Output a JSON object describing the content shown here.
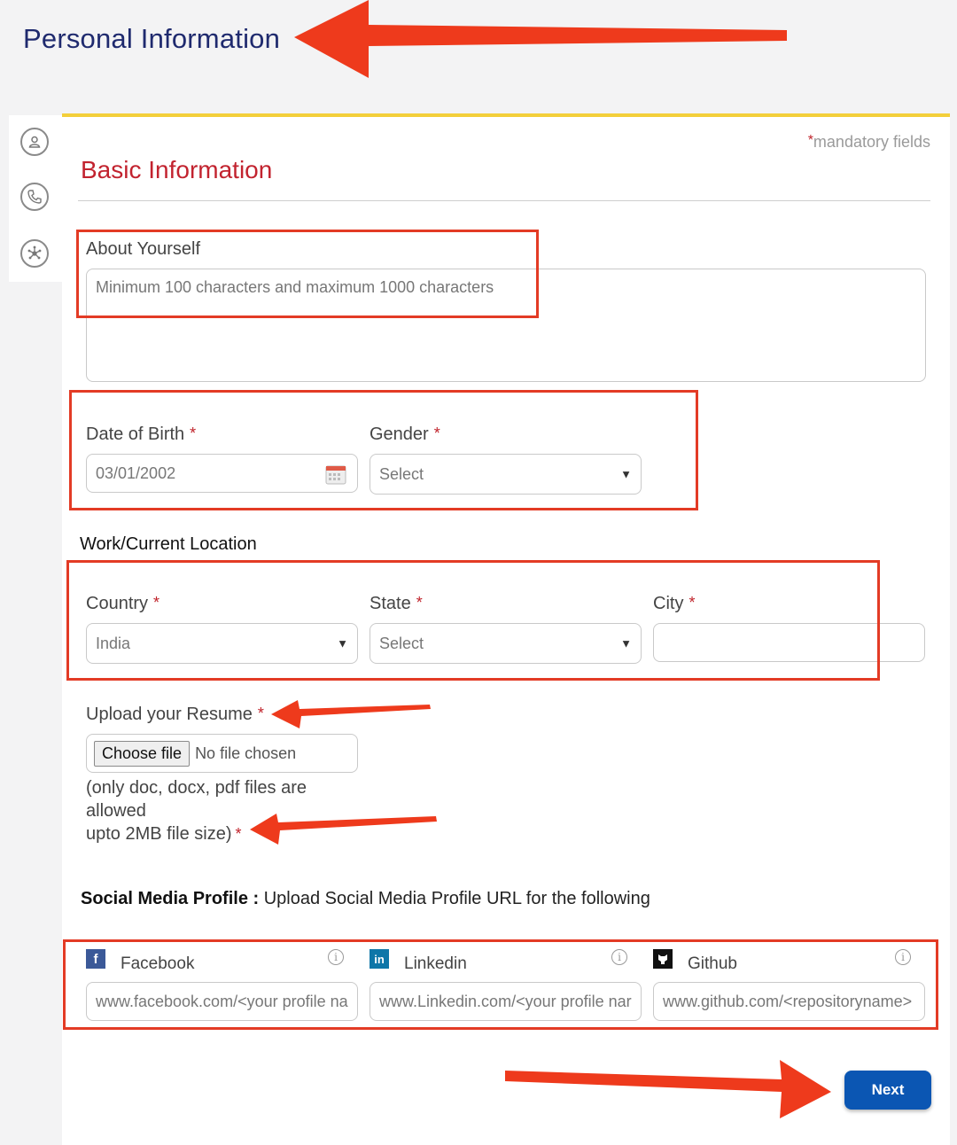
{
  "page": {
    "title": "Personal Information"
  },
  "form": {
    "mandatory_star": "*",
    "mandatory_note": "mandatory fields",
    "section_title": "Basic Information",
    "about": {
      "label": "About Yourself",
      "placeholder": "Minimum 100 characters and maximum 1000 characters"
    },
    "dob": {
      "label": "Date of Birth",
      "value": "03/01/2002"
    },
    "gender": {
      "label": "Gender",
      "value": "Select"
    },
    "location_heading": "Work/Current Location",
    "country": {
      "label": "Country",
      "value": "India"
    },
    "state": {
      "label": "State",
      "value": "Select"
    },
    "city": {
      "label": "City",
      "value": ""
    },
    "resume": {
      "label": "Upload your Resume",
      "button": "Choose file",
      "status": "No file chosen",
      "hint_line1": "(only doc, docx, pdf files are",
      "hint_line2": "allowed",
      "hint_line3": "upto 2MB file size)"
    },
    "social": {
      "heading_bold": "Social Media Profile :",
      "heading_text": " Upload Social Media Profile URL for the following",
      "facebook": {
        "label": "Facebook",
        "placeholder": "www.facebook.com/<your profile nar"
      },
      "linkedin": {
        "label": "Linkedin",
        "placeholder": "www.Linkedin.com/<your profile narr"
      },
      "github": {
        "label": "Github",
        "placeholder": "www.github.com/<repositoryname>"
      }
    },
    "required_star": "*",
    "next_label": "Next"
  },
  "colors": {
    "title": "#1f2a6e",
    "section_title": "#c2232f",
    "accent_border": "#f3cf3a",
    "next_button": "#0b56b3",
    "annotation_red": "#e33b25"
  },
  "icons": [
    "user-icon",
    "phone-icon",
    "network-icon",
    "calendar-icon",
    "facebook-icon",
    "linkedin-icon",
    "github-icon",
    "info-icon"
  ]
}
